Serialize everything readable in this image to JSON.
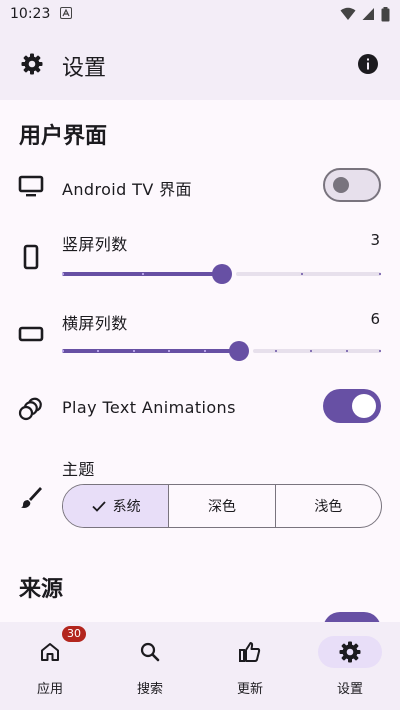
{
  "status_bar": {
    "time": "10:23"
  },
  "app_bar": {
    "title": "设置"
  },
  "ui_section": {
    "title": "用户界面",
    "android_tv": {
      "label": "Android TV 界面",
      "enabled": false
    },
    "portrait_columns": {
      "label": "竖屏列数",
      "value": "3",
      "min": 1,
      "max": 5,
      "current": 3
    },
    "landscape_columns": {
      "label": "横屏列数",
      "value": "6",
      "min": 1,
      "max": 10,
      "current": 6
    },
    "text_animations": {
      "label": "Play Text Animations",
      "enabled": true
    },
    "theme": {
      "label": "主题",
      "options": [
        "系统",
        "深色",
        "浅色"
      ],
      "selected": "系统"
    }
  },
  "source_section": {
    "title": "来源"
  },
  "bottom_nav": {
    "items": [
      {
        "label": "应用",
        "badge": "30",
        "icon": "home-icon"
      },
      {
        "label": "搜索",
        "icon": "search-icon"
      },
      {
        "label": "更新",
        "icon": "thumb-up-icon"
      },
      {
        "label": "设置",
        "icon": "gear-icon",
        "active": true
      }
    ]
  },
  "colors": {
    "accent": "#6750a4",
    "surface": "#f3edf7",
    "selected_container": "#e8def8",
    "badge": "#b3261e"
  }
}
